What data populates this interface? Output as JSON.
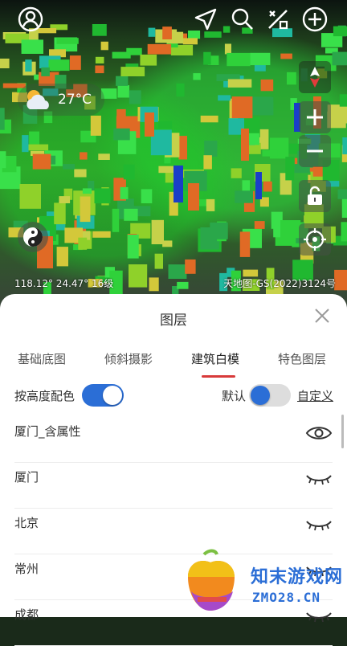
{
  "map": {
    "weather": {
      "temp": "27°C"
    },
    "coords": "118.12°  24.47°  16级",
    "copyright": "天地图-GS(2022)3124号"
  },
  "panel": {
    "title": "图层",
    "tabs": [
      "基础底图",
      "倾斜摄影",
      "建筑白模",
      "特色图层"
    ],
    "active_tab": 2,
    "height_color_label": "按高度配色",
    "height_color_on": true,
    "default_label": "默认",
    "default_on": false,
    "custom_label": "自定义",
    "layers": [
      {
        "name": "厦门_含属性",
        "icon": "eye-open-icon"
      },
      {
        "name": "厦门",
        "icon": "eye-closed-icon"
      },
      {
        "name": "北京",
        "icon": "eye-closed-icon"
      },
      {
        "name": "常州",
        "icon": "eye-closed-icon"
      },
      {
        "name": "成都",
        "icon": "eye-closed-icon"
      }
    ]
  },
  "watermark": {
    "line1": "知末游戏网",
    "line2": "ZMO28.CN"
  },
  "colors": {
    "accent": "#2b6ed6",
    "tab_underline": "#d83a3a",
    "toggle_off": "#dddddd"
  }
}
